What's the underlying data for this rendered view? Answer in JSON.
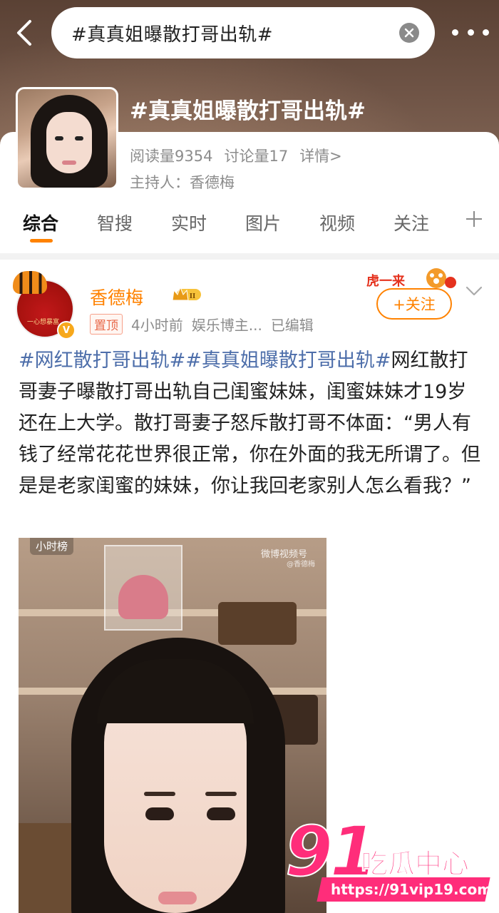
{
  "search": {
    "query": "#真真姐曝散打哥出轨#"
  },
  "topic": {
    "title": "#真真姐曝散打哥出轨#",
    "reads": "阅读量9354",
    "discussions": "讨论量17",
    "details": "详情>",
    "host": "主持人：香德梅"
  },
  "tabs": [
    {
      "label": "综合"
    },
    {
      "label": "智搜"
    },
    {
      "label": "实时"
    },
    {
      "label": "图片"
    },
    {
      "label": "视频"
    },
    {
      "label": "关注"
    }
  ],
  "post": {
    "user_name": "香德梅",
    "vip_level": "II",
    "pin_label": "置顶",
    "time": "4小时前",
    "source": "娱乐博主...",
    "edited": "已编辑",
    "follow_label": "+关注",
    "hashtag1": "#网红散打哥出轨#",
    "hashtag2": "#真真姐曝散打哥出轨#",
    "body": "网红散打哥妻子曝散打哥出轨自己闺蜜妹妹，闺蜜妹妹才19岁还在上大学。散打哥妻子怒斥散打哥不体面：“男人有钱了经常花花世界很正常，你在外面的我无所谓了。但是是老家闺蜜的妹妹，你让我回老家别人怎么看我？”",
    "image_badge": "小时榜",
    "image_watermark": "微博视频号",
    "image_watermark_user": "@香德梅",
    "avatar_text": "一心想暴富",
    "follow_deco_text": "虎一来"
  },
  "watermark": {
    "number": "91",
    "name": "吃瓜中心",
    "url": "https://91vip19.com"
  }
}
